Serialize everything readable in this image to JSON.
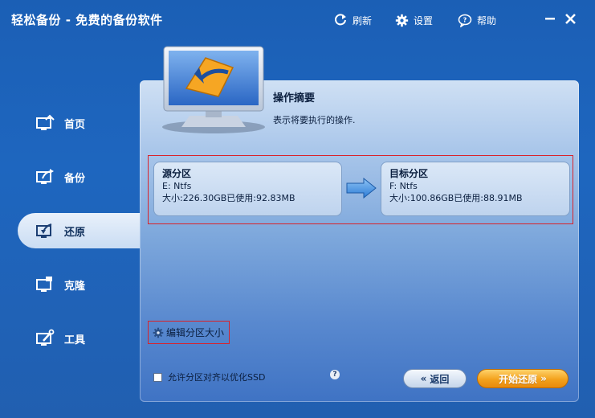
{
  "app": {
    "title": "轻松备份 - 免费的备份软件"
  },
  "toolbar": {
    "refresh_label": "刷新",
    "settings_label": "设置",
    "help_label": "帮助",
    "icons": [
      "refresh-icon",
      "gear-icon",
      "chat-help-icon",
      "minimize-icon",
      "close-icon"
    ]
  },
  "sidebar": {
    "items": [
      {
        "label": "首页",
        "icon": "home-monitor-icon",
        "active": false
      },
      {
        "label": "备份",
        "icon": "backup-monitor-icon",
        "active": false
      },
      {
        "label": "还原",
        "icon": "restore-monitor-icon",
        "active": true
      },
      {
        "label": "克隆",
        "icon": "clone-monitor-icon",
        "active": false
      },
      {
        "label": "工具",
        "icon": "tools-monitor-icon",
        "active": false
      }
    ]
  },
  "main": {
    "heading": "操作摘要",
    "subheading": "表示将要执行的操作.",
    "source": {
      "title": "源分区",
      "fs": "E: Ntfs",
      "size": "大小:226.30GB已使用:92.83MB"
    },
    "target": {
      "title": "目标分区",
      "fs": "F: Ntfs",
      "size": "大小:100.86GB已使用:88.91MB"
    },
    "resize_link": "编辑分区大小",
    "align_checkbox_label": "允许分区对齐以优化SSD",
    "align_checked": false,
    "help_mark": "?",
    "back_button": "返回",
    "start_button": "开始还原",
    "back_chevron": "«",
    "start_chevron": "»"
  },
  "colors": {
    "background": "#1e66bf",
    "active_nav": "#dce8f7",
    "highlight_frame": "#d9222a",
    "start_button": "#f3a11c"
  }
}
